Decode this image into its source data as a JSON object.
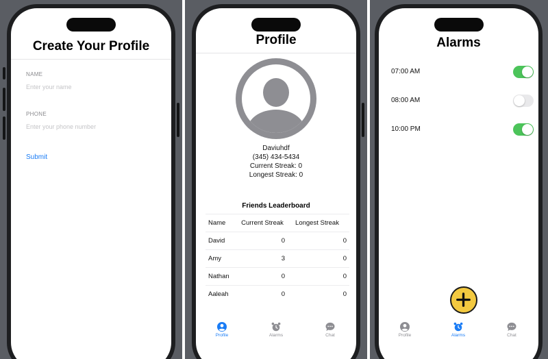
{
  "colors": {
    "accent": "#1a7cf5",
    "toggle_on": "#4cc45a",
    "toggle_off": "#e9e9eb",
    "fab": "#f3c940",
    "avatar": "#8e8e93",
    "inactive_tab": "#8e8e93"
  },
  "create_profile": {
    "title": "Create Your Profile",
    "name_label": "NAME",
    "name_placeholder": "Enter your name",
    "name_value": "",
    "phone_label": "PHONE",
    "phone_placeholder": "Enter your phone number",
    "phone_value": "",
    "submit_label": "Submit"
  },
  "profile": {
    "title": "Profile",
    "avatar_icon": "person-circle-icon",
    "username": "Daviuhdf",
    "phone": "(345) 434-5434",
    "current_streak": "Current Streak: 0",
    "longest_streak": "Longest Streak: 0",
    "leaderboard": {
      "title": "Friends Leaderboard",
      "columns": [
        "Name",
        "Current Streak",
        "Longest Streak"
      ],
      "rows": [
        {
          "name": "David",
          "current": "0",
          "longest": "0"
        },
        {
          "name": "Amy",
          "current": "3",
          "longest": "0"
        },
        {
          "name": "Nathan",
          "current": "0",
          "longest": "0"
        },
        {
          "name": "Aaleah",
          "current": "0",
          "longest": "0"
        }
      ]
    }
  },
  "alarms": {
    "title": "Alarms",
    "items": [
      {
        "time": "07:00 AM",
        "enabled": true
      },
      {
        "time": "08:00 AM",
        "enabled": false
      },
      {
        "time": "10:00 PM",
        "enabled": true
      }
    ],
    "add_icon": "plus-icon"
  },
  "tabbar": {
    "profile_label": "Profile",
    "alarms_label": "Alarms",
    "chat_label": "Chat",
    "icons": [
      "person-icon",
      "alarm-clock-icon",
      "chat-bubble-icon"
    ]
  }
}
